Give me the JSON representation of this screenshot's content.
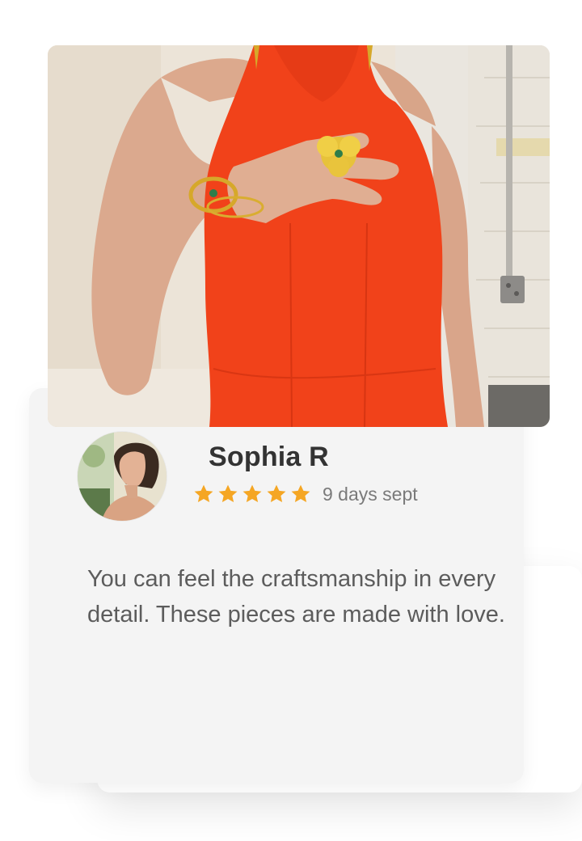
{
  "review": {
    "reviewer_name": "Sophia R",
    "rating": 5,
    "rating_max": 5,
    "date_text": "9 days sept",
    "text": "You can feel the craftsmanship in every detail. These pieces are made with love."
  },
  "icons": {
    "star": "star-icon",
    "star_color": "#f5a623"
  },
  "colors": {
    "card_background": "#f4f4f4",
    "name_color": "#333333",
    "text_color": "#5c5c5c",
    "date_color": "#7a7a7a",
    "dress_color": "#f1421a"
  }
}
